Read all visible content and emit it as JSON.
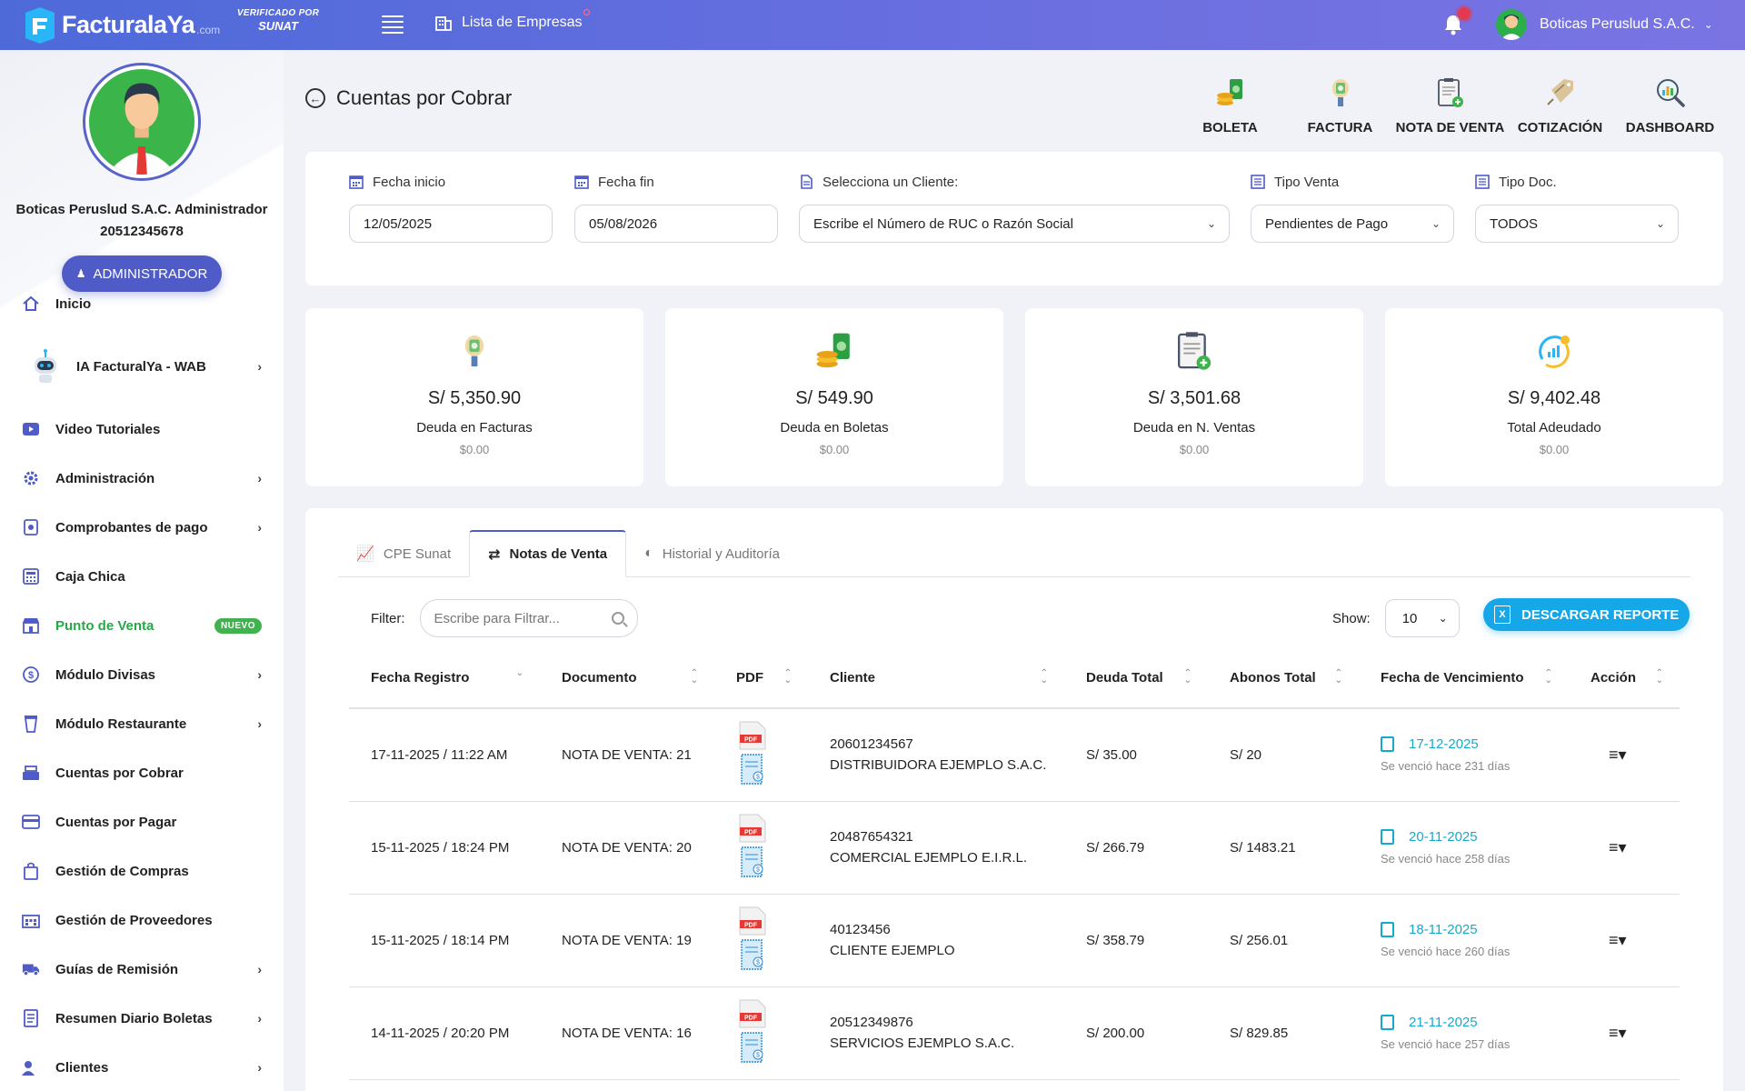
{
  "topbar": {
    "logo_main": "Facturala",
    "logo_ya": "Ya",
    "logo_com": ".com",
    "sunat_top": "VERIFICADO POR",
    "sunat_bottom": "SUNAT",
    "empresas": "Lista de Empresas",
    "user": "Boticas Peruslud S.A.C."
  },
  "profile": {
    "name_line1": "Boticas Peruslud S.A.C. Administrador",
    "name_line2": "20512345678",
    "role_button": "ADMINISTRADOR"
  },
  "nav": {
    "inicio": "Inicio",
    "ia": "IA FacturalYa - WAB",
    "videos": "Video Tutoriales",
    "admin": "Administración",
    "comprobantes": "Comprobantes de pago",
    "caja": "Caja Chica",
    "pv": "Punto de Venta",
    "pv_badge": "NUEVO",
    "divisas": "Módulo Divisas",
    "restaurante": "Módulo Restaurante",
    "cobrar": "Cuentas por Cobrar",
    "pagar": "Cuentas por Pagar",
    "compras": "Gestión de Compras",
    "proveedores": "Gestión de Proveedores",
    "guias": "Guías de Remisión",
    "resumen": "Resumen Diario Boletas",
    "clientes": "Clientes"
  },
  "page": {
    "title": "Cuentas por Cobrar",
    "shortcuts": [
      "BOLETA",
      "FACTURA",
      "NOTA DE VENTA",
      "COTIZACIÓN",
      "DASHBOARD"
    ]
  },
  "filters": {
    "fecha_inicio_label": "Fecha inicio",
    "fecha_inicio": "12/05/2025",
    "fecha_fin_label": "Fecha fin",
    "fecha_fin": "05/08/2026",
    "cliente_label": "Selecciona un Cliente:",
    "cliente_value": "Escribe el Número de RUC o Razón Social",
    "tipo_venta_label": "Tipo Venta",
    "tipo_venta": "Pendientes de Pago",
    "tipo_doc_label": "Tipo Doc.",
    "tipo_doc": "TODOS"
  },
  "cards": [
    {
      "amount": "S/ 5,350.90",
      "label": "Deuda en Facturas",
      "sub": "$0.00"
    },
    {
      "amount": "S/ 549.90",
      "label": "Deuda en Boletas",
      "sub": "$0.00"
    },
    {
      "amount": "S/ 3,501.68",
      "label": "Deuda en N. Ventas",
      "sub": "$0.00"
    },
    {
      "amount": "S/ 9,402.48",
      "label": "Total Adeudado",
      "sub": "$0.00"
    }
  ],
  "tabs": [
    "CPE Sunat",
    "Notas de Venta",
    "Historial y Auditoría"
  ],
  "toolbar": {
    "filter_label": "Filter:",
    "filter_placeholder": "Escribe para Filtrar...",
    "show_label": "Show:",
    "show_value": "10",
    "download": "DESCARGAR REPORTE"
  },
  "table": {
    "headers": [
      "Fecha Registro",
      "Documento",
      "PDF",
      "Cliente",
      "Deuda Total",
      "Abonos Total",
      "Fecha de Vencimiento",
      "Acción"
    ],
    "rows": [
      {
        "fecha": "17-11-2025 / 11:22 AM",
        "doc": "NOTA DE VENTA: 21",
        "ruc": "20601234567",
        "cliente": "DISTRIBUIDORA EJEMPLO S.A.C.",
        "deuda": "S/ 35.00",
        "abonos": "S/ 20",
        "venc": "17-12-2025",
        "venc_sub": "Se venció hace 231 días"
      },
      {
        "fecha": "15-11-2025 / 18:24 PM",
        "doc": "NOTA DE VENTA: 20",
        "ruc": "20487654321",
        "cliente": "COMERCIAL EJEMPLO E.I.R.L.",
        "deuda": "S/ 266.79",
        "abonos": "S/ 1483.21",
        "venc": "20-11-2025",
        "venc_sub": "Se venció hace 258 días"
      },
      {
        "fecha": "15-11-2025 / 18:14 PM",
        "doc": "NOTA DE VENTA: 19",
        "ruc": "40123456",
        "cliente": "CLIENTE EJEMPLO",
        "deuda": "S/ 358.79",
        "abonos": "S/ 256.01",
        "venc": "18-11-2025",
        "venc_sub": "Se venció hace 260 días"
      },
      {
        "fecha": "14-11-2025 / 20:20 PM",
        "doc": "NOTA DE VENTA: 16",
        "ruc": "20512349876",
        "cliente": "SERVICIOS EJEMPLO S.A.C.",
        "deuda": "S/ 200.00",
        "abonos": "S/ 829.85",
        "venc": "21-11-2025",
        "venc_sub": "Se venció hace 257 días"
      }
    ]
  },
  "colors": {
    "accent": "#4f5bc6",
    "topbar": "#5b6ddc",
    "link": "#17a9c9",
    "button": "#16a7e8",
    "success": "#40b34f"
  }
}
